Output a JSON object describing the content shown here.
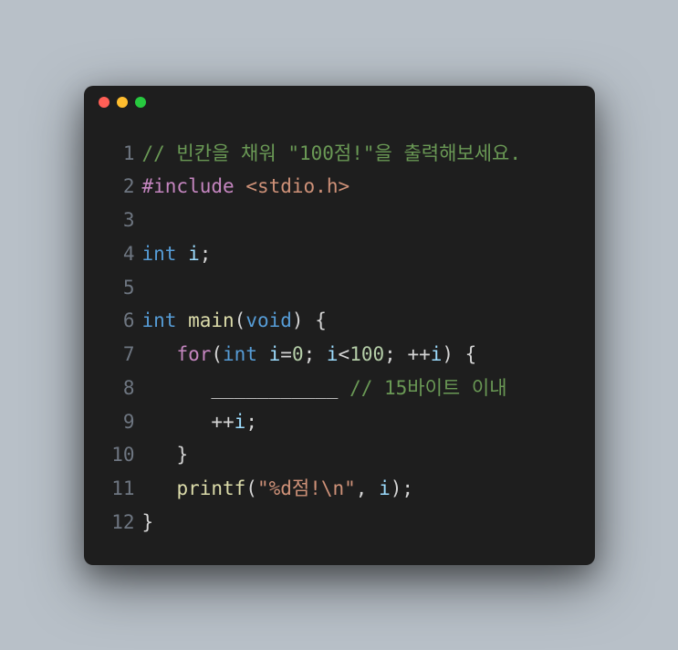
{
  "window": {
    "dots": [
      "red",
      "yellow",
      "green"
    ]
  },
  "code": {
    "lines": [
      {
        "n": "1",
        "tokens": [
          {
            "cls": "comment",
            "t": "// 빈칸을 채워 \"100점!\"을 출력해보세요."
          }
        ]
      },
      {
        "n": "2",
        "tokens": [
          {
            "cls": "preproc",
            "t": "#include"
          },
          {
            "cls": "plain",
            "t": " "
          },
          {
            "cls": "include-str",
            "t": "<stdio.h>"
          }
        ]
      },
      {
        "n": "3",
        "tokens": []
      },
      {
        "n": "4",
        "tokens": [
          {
            "cls": "type",
            "t": "int"
          },
          {
            "cls": "plain",
            "t": " "
          },
          {
            "cls": "ident",
            "t": "i"
          },
          {
            "cls": "punct",
            "t": ";"
          }
        ]
      },
      {
        "n": "5",
        "tokens": []
      },
      {
        "n": "6",
        "tokens": [
          {
            "cls": "type",
            "t": "int"
          },
          {
            "cls": "plain",
            "t": " "
          },
          {
            "cls": "func",
            "t": "main"
          },
          {
            "cls": "punct",
            "t": "("
          },
          {
            "cls": "type",
            "t": "void"
          },
          {
            "cls": "punct",
            "t": ") {"
          }
        ]
      },
      {
        "n": "7",
        "tokens": [
          {
            "cls": "plain",
            "t": "   "
          },
          {
            "cls": "keyword",
            "t": "for"
          },
          {
            "cls": "punct",
            "t": "("
          },
          {
            "cls": "type",
            "t": "int"
          },
          {
            "cls": "plain",
            "t": " "
          },
          {
            "cls": "ident",
            "t": "i"
          },
          {
            "cls": "op",
            "t": "="
          },
          {
            "cls": "number",
            "t": "0"
          },
          {
            "cls": "punct",
            "t": "; "
          },
          {
            "cls": "ident",
            "t": "i"
          },
          {
            "cls": "op",
            "t": "<"
          },
          {
            "cls": "number",
            "t": "100"
          },
          {
            "cls": "punct",
            "t": "; "
          },
          {
            "cls": "op",
            "t": "++"
          },
          {
            "cls": "ident",
            "t": "i"
          },
          {
            "cls": "punct",
            "t": ") {"
          }
        ]
      },
      {
        "n": "8",
        "tokens": [
          {
            "cls": "plain",
            "t": "      ___________ "
          },
          {
            "cls": "comment",
            "t": "// 15바이트 이내"
          }
        ]
      },
      {
        "n": "9",
        "tokens": [
          {
            "cls": "plain",
            "t": "      "
          },
          {
            "cls": "op",
            "t": "++"
          },
          {
            "cls": "ident",
            "t": "i"
          },
          {
            "cls": "punct",
            "t": ";"
          }
        ]
      },
      {
        "n": "10",
        "tokens": [
          {
            "cls": "plain",
            "t": "   "
          },
          {
            "cls": "punct",
            "t": "}"
          }
        ]
      },
      {
        "n": "11",
        "tokens": [
          {
            "cls": "plain",
            "t": "   "
          },
          {
            "cls": "func",
            "t": "printf"
          },
          {
            "cls": "punct",
            "t": "("
          },
          {
            "cls": "string",
            "t": "\"%d점!\\n\""
          },
          {
            "cls": "punct",
            "t": ", "
          },
          {
            "cls": "ident",
            "t": "i"
          },
          {
            "cls": "punct",
            "t": ");"
          }
        ]
      },
      {
        "n": "12",
        "tokens": [
          {
            "cls": "punct",
            "t": "}"
          }
        ]
      }
    ]
  }
}
